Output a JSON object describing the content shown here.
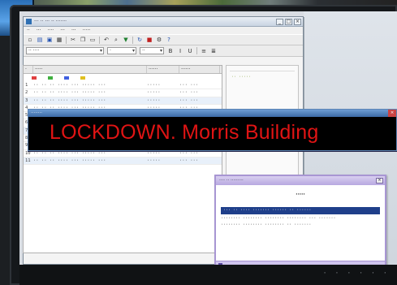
{
  "app": {
    "title": "··· ·· ··· ·· ·······",
    "window_buttons": [
      "_",
      "□",
      "×"
    ],
    "menu": [
      "··",
      "···",
      "····",
      "···",
      "···",
      "·····"
    ]
  },
  "toolbar": {
    "icons": [
      "new-icon",
      "open-icon",
      "save-icon",
      "print-icon",
      "cut-icon",
      "copy-icon",
      "paste-icon",
      "undo-icon",
      "find-icon",
      "filter-icon",
      "refresh-icon",
      "stop-icon",
      "settings-icon",
      "help-icon"
    ]
  },
  "format_bar": {
    "combo1_value": "·· ····",
    "combo2_value": "·",
    "combo3_value": "··"
  },
  "grid": {
    "headers": [
      "·",
      "·····",
      "······",
      "······"
    ],
    "rows": [
      [
        "1",
        "·· ·· ·· ···· ··· ····· ···",
        "·····",
        "··· ···"
      ],
      [
        "2",
        "·· ·· ·· ···· ··· ····· ···",
        "·····",
        "··· ···"
      ],
      [
        "3",
        "·· ·· ·· ···· ··· ····· ···",
        "·····",
        "··· ···"
      ],
      [
        "4",
        "·· ·· ·· ···· ··· ····· ···",
        "·····",
        "··· ···"
      ],
      [
        "5",
        "·· ·· ·· ···· ··· ····· ···",
        "·····",
        "··· ···"
      ],
      [
        "6",
        "·· ·· ·· ···· ··· ····· ···",
        "·····",
        "··· ···"
      ],
      [
        "7",
        "·· ·· ·· ···· ··· ····· ···",
        "·····",
        "··· ···"
      ],
      [
        "8",
        "·· ·· ·· ···· ··· ····· ···",
        "·····",
        "··· ···"
      ],
      [
        "9",
        "·· ·· ·· ···· ··· ····· ···",
        "·····",
        "··· ···"
      ],
      [
        "10",
        "·· ·· ·· ···· ··· ····· ···",
        "·····",
        "··· ···"
      ],
      [
        "11",
        "·· ·· ·· ···· ··· ····· ···",
        "·····",
        "··· ···"
      ]
    ],
    "legend_colors": [
      "#e04040",
      "#40b040",
      "#4060e0",
      "#e0c020"
    ]
  },
  "side_panel": {
    "text": "·· ·····"
  },
  "alert": {
    "window_title": "········",
    "message": "LOCKDOWN. Morris Building",
    "color": "#e01414"
  },
  "dialog": {
    "title": "···· ·· ·········",
    "heading": "·····",
    "selected_line": "··· ·· ···· ······· ······ ·· ······",
    "lines": [
      "········ ········ ········ ········ ··· ·······",
      "········ ········ ········ ·· ·······"
    ]
  },
  "taskbar": {
    "tray": "· · · · · ·"
  }
}
